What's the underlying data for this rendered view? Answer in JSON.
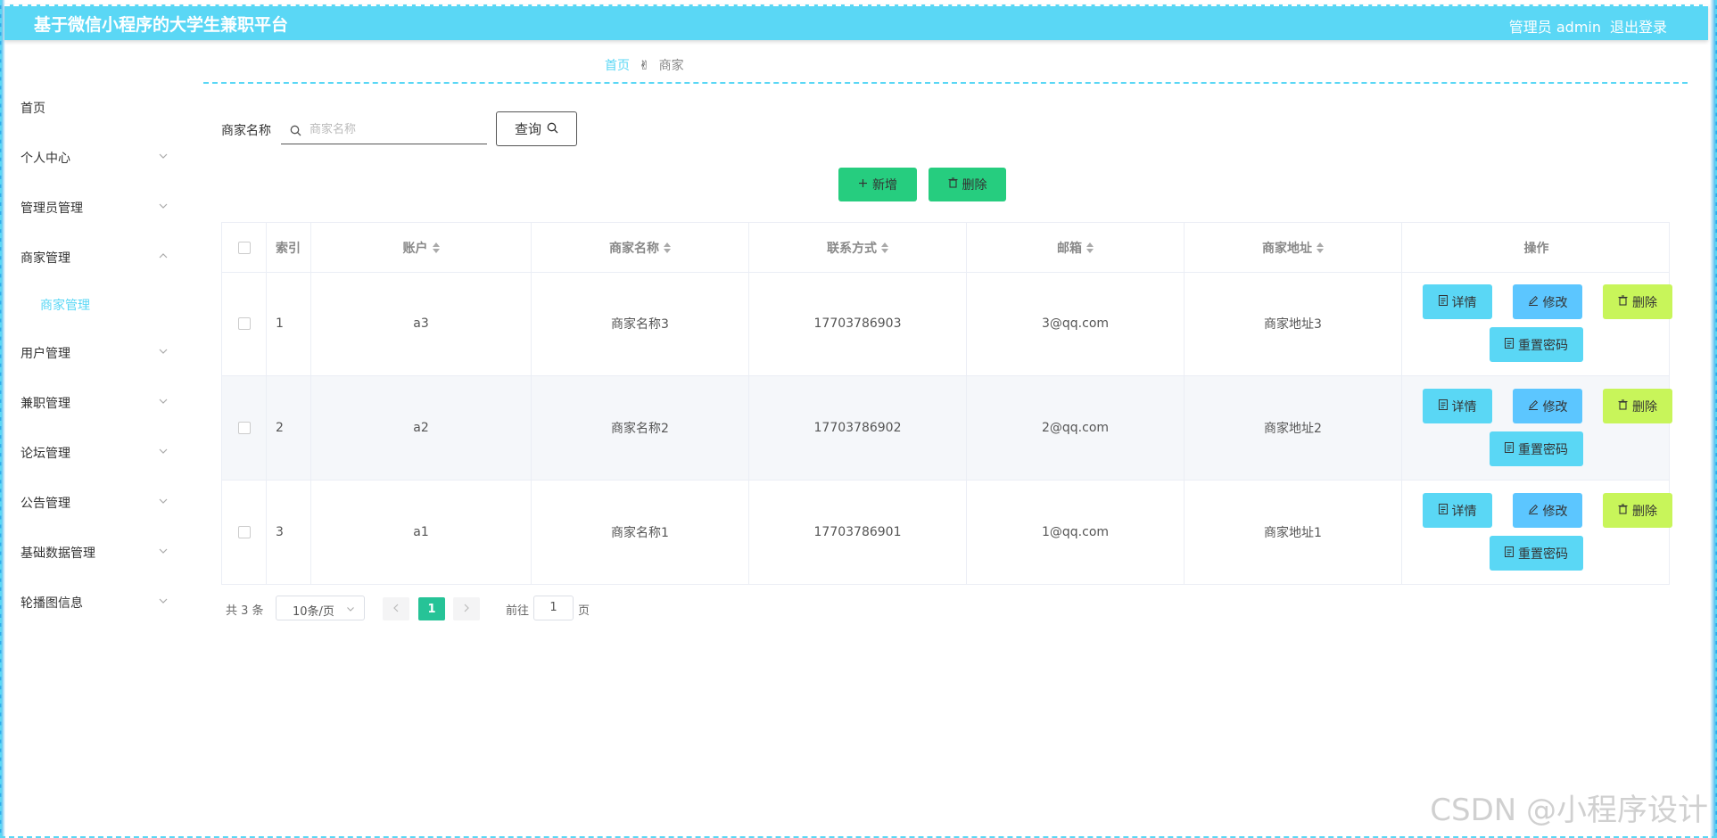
{
  "header": {
    "title": "基于微信小程序的大学生兼职平台",
    "user": "管理员 admin",
    "logout": "退出登录"
  },
  "sidebar": {
    "items": [
      {
        "label": "首页"
      },
      {
        "label": "个人中心"
      },
      {
        "label": "管理员管理"
      },
      {
        "label": "商家管理"
      },
      {
        "label": "用户管理"
      },
      {
        "label": "兼职管理"
      },
      {
        "label": "论坛管理"
      },
      {
        "label": "公告管理"
      },
      {
        "label": "基础数据管理"
      },
      {
        "label": "轮播图信息"
      }
    ],
    "submenu": {
      "label": "商家管理"
    }
  },
  "breadcrumb": {
    "home": "首页",
    "separator": "✌",
    "current": "商家"
  },
  "search": {
    "label": "商家名称",
    "placeholder": "商家名称",
    "query_label": "查询"
  },
  "actions": {
    "add_label": "新增",
    "delete_label": "删除"
  },
  "table": {
    "headers": {
      "index": "索引",
      "account": "账户",
      "name": "商家名称",
      "contact": "联系方式",
      "email": "邮箱",
      "address": "商家地址",
      "ops": "操作"
    },
    "rows": [
      {
        "index": "1",
        "account": "a3",
        "name": "商家名称3",
        "contact": "17703786903",
        "email": "3@qq.com",
        "address": "商家地址3"
      },
      {
        "index": "2",
        "account": "a2",
        "name": "商家名称2",
        "contact": "17703786902",
        "email": "2@qq.com",
        "address": "商家地址2"
      },
      {
        "index": "3",
        "account": "a1",
        "name": "商家名称1",
        "contact": "17703786901",
        "email": "1@qq.com",
        "address": "商家地址1"
      }
    ],
    "op_labels": {
      "detail": "详情",
      "edit": "修改",
      "delete": "删除",
      "reset": "重置密码"
    }
  },
  "pagination": {
    "total": "共 3 条",
    "page_size": "10条/页",
    "current_page": "1",
    "goto_label": "前往",
    "goto_value": "1",
    "unit": "页"
  },
  "watermark": "CSDN @小程序设计",
  "colors": {
    "primary": "#5ad7f5",
    "success": "#26cd7f",
    "warning": "#c8f55a",
    "pager_active": "#26c397"
  }
}
